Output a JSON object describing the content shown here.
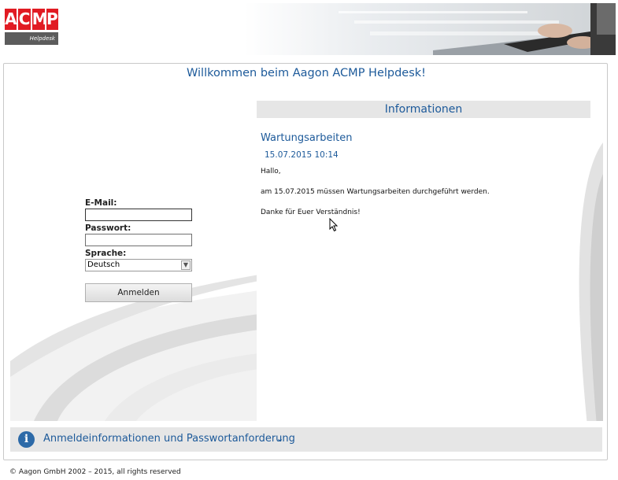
{
  "logo": {
    "letters": [
      "A",
      "C",
      "M",
      "P"
    ],
    "subtitle": "Helpdesk",
    "color": "#e11b23"
  },
  "header": {
    "welcome": "Willkommen beim Aagon ACMP Helpdesk!"
  },
  "login": {
    "email_label": "E-Mail:",
    "email_value": "",
    "password_label": "Passwort:",
    "password_value": "",
    "language_label": "Sprache:",
    "language_selected": "Deutsch",
    "submit_label": "Anmelden"
  },
  "info": {
    "title": "Informationen",
    "news": {
      "title": "Wartungsarbeiten",
      "date": "15.07.2015 10:14",
      "greeting": "Hallo,",
      "body": "am 15.07.2015 müssen Wartungsarbeiten durchgeführt werden.",
      "closing": "Danke für Euer Verständnis!"
    }
  },
  "footer_bar": {
    "label": "Anmeldeinformationen und Passwortanforderung",
    "chevron": "⌄",
    "icon": "info-icon"
  },
  "copyright": "© Aagon GmbH 2002 – 2015, all rights reserved",
  "colors": {
    "accent": "#1d5a9a",
    "panel": "#e6e6e6",
    "brand": "#e11b23"
  }
}
